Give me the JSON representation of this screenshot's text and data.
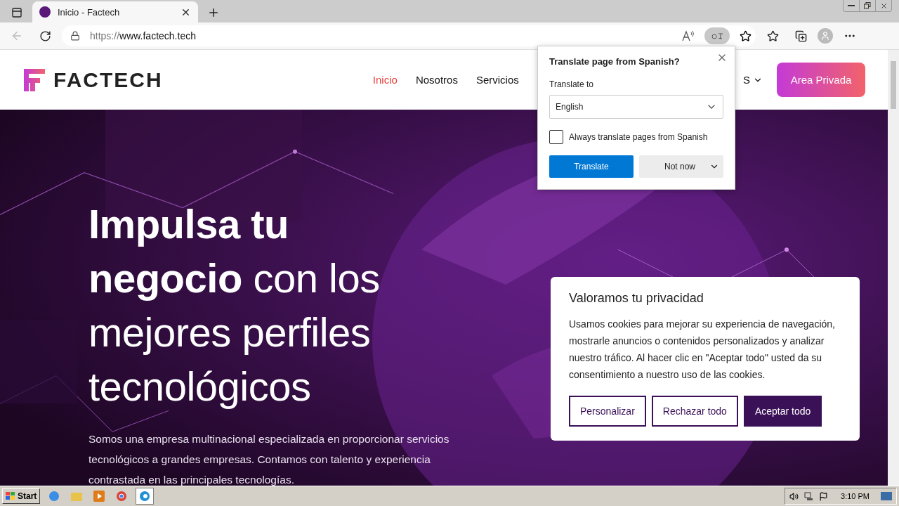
{
  "browser": {
    "tabs": [
      {
        "title": "Inicio - Factech",
        "selected": true
      }
    ],
    "url": {
      "scheme": "https://",
      "host": "www.factech.tech"
    }
  },
  "site": {
    "logo": "FACTECH",
    "nav": [
      {
        "label": "Inicio",
        "selected": true
      },
      {
        "label": "Nosotros",
        "selected": false
      },
      {
        "label": "Servicios",
        "selected": false
      }
    ],
    "language": "S",
    "cta": "Area Privada"
  },
  "hero": {
    "heading": "**Impulsa tu negocio** con los mejores perfiles tecnológicos",
    "text": "Somos una empresa multinacional especializada en proporcionar servicios tecnológicos a grandes empresas. Contamos con talento y experiencia contrastada en las principales tecnologías."
  },
  "translate": {
    "title": "Translate page from  Spanish?",
    "label": "Translate to",
    "language": "English",
    "checkbox": {
      "label": "Always translate pages from Spanish",
      "checked": false
    },
    "primary": "Translate",
    "secondary": "Not now"
  },
  "cookie": {
    "title": "Valoramos tu privacidad",
    "text": "Usamos cookies para mejorar su experiencia de navegación, mostrarle anuncios o contenidos personalizados y analizar nuestro tráfico. Al hacer clic en \"Aceptar todo\" usted da su consentimiento a nuestro uso de las cookies.",
    "buttons": [
      {
        "label": "Personalizar",
        "kind": "outline"
      },
      {
        "label": "Rechazar todo",
        "kind": "outline"
      },
      {
        "label": "Aceptar todo",
        "kind": "filled"
      }
    ]
  },
  "taskbar": {
    "start": "Start",
    "clock": "3:10 PM"
  }
}
